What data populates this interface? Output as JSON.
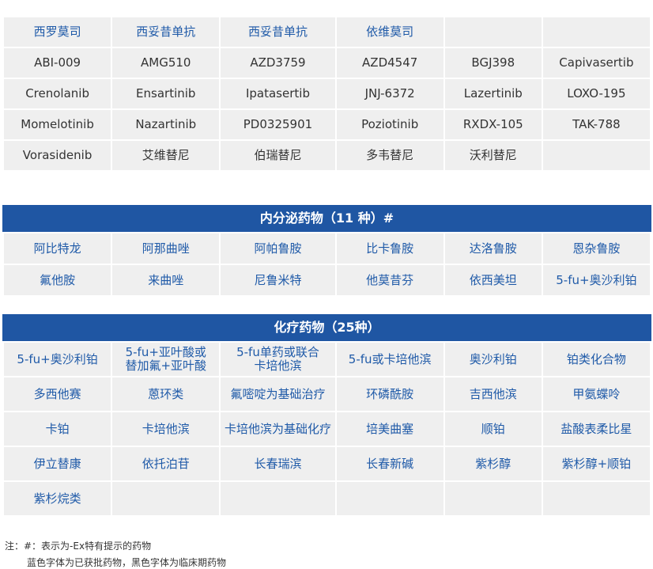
{
  "section1": {
    "rows": [
      [
        {
          "t": "西罗莫司",
          "c": "blue"
        },
        {
          "t": "西妥昔单抗",
          "c": "blue"
        },
        {
          "t": "西妥昔单抗",
          "c": "blue"
        },
        {
          "t": "依维莫司",
          "c": "blue"
        },
        {
          "t": "",
          "c": "blue"
        },
        {
          "t": "",
          "c": "blue"
        }
      ],
      [
        {
          "t": "ABI-009",
          "c": "black"
        },
        {
          "t": "AMG510",
          "c": "black"
        },
        {
          "t": "AZD3759",
          "c": "black"
        },
        {
          "t": "AZD4547",
          "c": "black"
        },
        {
          "t": "BGJ398",
          "c": "black"
        },
        {
          "t": "Capivasertib",
          "c": "black"
        }
      ],
      [
        {
          "t": "Crenolanib",
          "c": "black"
        },
        {
          "t": "Ensartinib",
          "c": "black"
        },
        {
          "t": "Ipatasertib",
          "c": "black"
        },
        {
          "t": "JNJ-6372",
          "c": "black"
        },
        {
          "t": "Lazertinib",
          "c": "black"
        },
        {
          "t": "LOXO-195",
          "c": "black"
        }
      ],
      [
        {
          "t": "Momelotinib",
          "c": "black"
        },
        {
          "t": "Nazartinib",
          "c": "black"
        },
        {
          "t": "PD0325901",
          "c": "black"
        },
        {
          "t": "Poziotinib",
          "c": "black"
        },
        {
          "t": "RXDX-105",
          "c": "black"
        },
        {
          "t": "TAK-788",
          "c": "black"
        }
      ],
      [
        {
          "t": "Vorasidenib",
          "c": "black"
        },
        {
          "t": "艾维替尼",
          "c": "black"
        },
        {
          "t": "伯瑞替尼",
          "c": "black"
        },
        {
          "t": "多韦替尼",
          "c": "black"
        },
        {
          "t": "沃利替尼",
          "c": "black"
        },
        {
          "t": "",
          "c": "black"
        }
      ]
    ]
  },
  "section2": {
    "title": "内分泌药物（11 种）#",
    "rows": [
      [
        {
          "t": "阿比特龙",
          "c": "blue"
        },
        {
          "t": "阿那曲唑",
          "c": "blue"
        },
        {
          "t": "阿帕鲁胺",
          "c": "blue"
        },
        {
          "t": "比卡鲁胺",
          "c": "blue"
        },
        {
          "t": "达洛鲁胺",
          "c": "blue"
        },
        {
          "t": "恩杂鲁胺",
          "c": "blue"
        }
      ],
      [
        {
          "t": "氟他胺",
          "c": "blue"
        },
        {
          "t": "来曲唑",
          "c": "blue"
        },
        {
          "t": "尼鲁米特",
          "c": "blue"
        },
        {
          "t": "他莫昔芬",
          "c": "blue"
        },
        {
          "t": "依西美坦",
          "c": "blue"
        },
        {
          "t": "5-fu+奥沙利铂",
          "c": "blue"
        }
      ]
    ]
  },
  "section3": {
    "title": "化疗药物（25种）",
    "rows": [
      [
        {
          "t": "5-fu+奥沙利铂",
          "c": "blue"
        },
        {
          "t": "5-fu+亚叶酸或\n替加氟+亚叶酸",
          "c": "blue"
        },
        {
          "t": "5-fu单药或联合\n卡培他滨",
          "c": "blue"
        },
        {
          "t": "5-fu或卡培他滨",
          "c": "blue"
        },
        {
          "t": "奥沙利铂",
          "c": "blue"
        },
        {
          "t": "铂类化合物",
          "c": "blue"
        }
      ],
      [
        {
          "t": "多西他赛",
          "c": "blue"
        },
        {
          "t": "蒽环类",
          "c": "blue"
        },
        {
          "t": "氟嘧啶为基础治疗",
          "c": "blue"
        },
        {
          "t": "环磷酰胺",
          "c": "blue"
        },
        {
          "t": "吉西他滨",
          "c": "blue"
        },
        {
          "t": "甲氨蝶呤",
          "c": "blue"
        }
      ],
      [
        {
          "t": "卡铂",
          "c": "blue"
        },
        {
          "t": "卡培他滨",
          "c": "blue"
        },
        {
          "t": "卡培他滨为基础化疗",
          "c": "blue"
        },
        {
          "t": "培美曲塞",
          "c": "blue"
        },
        {
          "t": "顺铂",
          "c": "blue"
        },
        {
          "t": "盐酸表柔比星",
          "c": "blue"
        }
      ],
      [
        {
          "t": "伊立替康",
          "c": "blue"
        },
        {
          "t": "依托泊苷",
          "c": "blue"
        },
        {
          "t": "长春瑞滨",
          "c": "blue"
        },
        {
          "t": "长春新碱",
          "c": "blue"
        },
        {
          "t": "紫杉醇",
          "c": "blue"
        },
        {
          "t": "紫杉醇+顺铂",
          "c": "blue"
        }
      ],
      [
        {
          "t": "紫杉烷类",
          "c": "blue"
        },
        {
          "t": "",
          "c": "blue"
        },
        {
          "t": "",
          "c": "blue"
        },
        {
          "t": "",
          "c": "blue"
        },
        {
          "t": "",
          "c": "blue"
        },
        {
          "t": "",
          "c": "blue"
        }
      ]
    ]
  },
  "notes": {
    "line1": "注：#：表示为-Ex特有提示的药物",
    "line2": "蓝色字体为已获批药物，黑色字体为临床期药物"
  },
  "colors": {
    "header_bg": "#1f56a3",
    "approved_text": "#1f5aa8",
    "clinical_text": "#333333",
    "cell_bg": "#efefef"
  }
}
